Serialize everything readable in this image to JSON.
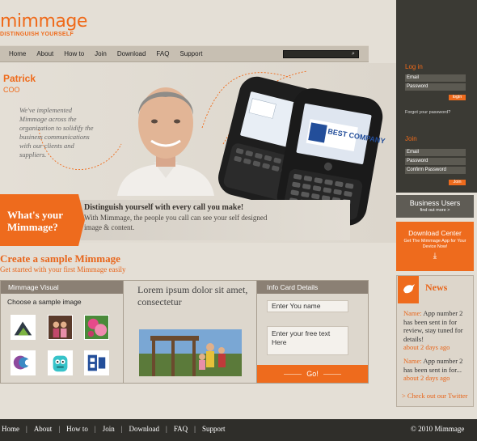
{
  "brand": {
    "logo": "mimmage",
    "tagline": "DISTINGUISH YOURSELF"
  },
  "nav": [
    "Home",
    "About",
    "How to",
    "Join",
    "Download",
    "FAQ",
    "Support"
  ],
  "search": {
    "button_icon": "search-icon"
  },
  "hero": {
    "name": "Patrick",
    "role": "COO",
    "quote": "We've implemented Mimmage across the organization to solidify the business communications with our clients and suppliers.",
    "phone_screen_text": "BEST COMPANY"
  },
  "banner": {
    "label_line1": "What's your",
    "label_line2": "Mimmage?",
    "heading": "Distinguish yourself with every call you make!",
    "body": "With Mimmage, the people you call can see your self designed image & content."
  },
  "create": {
    "title": "Create a sample Mimmage",
    "subtitle": "Get started with your first Mimmage easily"
  },
  "mimmage_visual": {
    "header": "Mimmage Visual",
    "instruction": "Choose a sample image"
  },
  "preview": {
    "title": "Lorem ipsum dolor sit amet, consectetur"
  },
  "info_card": {
    "header": "Info Card Details",
    "name_placeholder": "Enter You name",
    "text_placeholder": "Enter your free text Here",
    "go": "Go!"
  },
  "login": {
    "title": "Log in",
    "email": "Email",
    "password": "Password",
    "button": "login",
    "forgot": "Forgot your password?"
  },
  "join": {
    "title": "Join",
    "email": "Email",
    "password": "Password",
    "confirm": "Confirm Password",
    "button": "Join"
  },
  "business": {
    "title": "Business Users",
    "link": "find out more >"
  },
  "download": {
    "title": "Download Center",
    "text": "Get The Mimmage App for Your Device Now!",
    "icon": "download-arrow-icon"
  },
  "news": {
    "title": "News",
    "items": [
      {
        "name": "Name:",
        "text": "App number 2 has been sent in for review, stay tuned for details!",
        "date": "about 2 days ago"
      },
      {
        "name": "Name:",
        "text": "App number 2 has been sent in for...",
        "date": "about 2 days ago"
      }
    ],
    "twitter": "> Check out our Twitter"
  },
  "footer": {
    "links": [
      "Home",
      "About",
      "How to",
      "Join",
      "Download",
      "FAQ",
      "Support"
    ],
    "separator": "|",
    "copyright": "© 2010 Mimmage"
  },
  "colors": {
    "accent": "#ee6b1d",
    "dark": "#3b3a34",
    "background": "#e4dfd6"
  }
}
